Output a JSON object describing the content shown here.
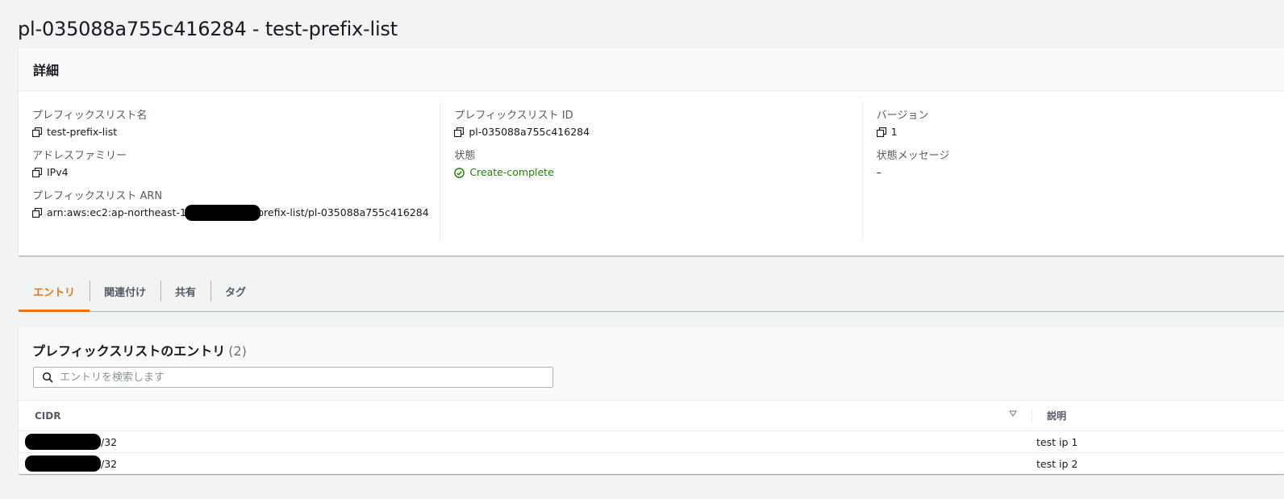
{
  "page": {
    "title": "pl-035088a755c416284 - test-prefix-list"
  },
  "details": {
    "header": "詳細",
    "fields": {
      "name_label": "プレフィックスリスト名",
      "name_value": "test-prefix-list",
      "family_label": "アドレスファミリー",
      "family_value": "IPv4",
      "arn_label": "プレフィックスリスト ARN",
      "arn_prefix": "arn:aws:ec2:ap-northeast-1:",
      "arn_suffix": "prefix-list/pl-035088a755c416284",
      "id_label": "プレフィックスリスト ID",
      "id_value": "pl-035088a755c416284",
      "state_label": "状態",
      "state_value": "Create-complete",
      "version_label": "バージョン",
      "version_value": "1",
      "state_message_label": "状態メッセージ",
      "state_message_value": "–"
    }
  },
  "tabs": [
    {
      "label": "エントリ",
      "active": true
    },
    {
      "label": "関連付け",
      "active": false
    },
    {
      "label": "共有",
      "active": false
    },
    {
      "label": "タグ",
      "active": false
    }
  ],
  "entries": {
    "title": "プレフィックスリストのエントリ",
    "count": "(2)",
    "search_placeholder": "エントリを検索します",
    "columns": {
      "cidr": "CIDR",
      "description": "説明"
    },
    "rows": [
      {
        "cidr_suffix": "/32",
        "description": "test ip 1"
      },
      {
        "cidr_suffix": "/32",
        "description": "test ip 2"
      }
    ]
  },
  "colors": {
    "accent": "#ec7211",
    "success": "#1d8102",
    "background": "#f2f3f3"
  },
  "icons": [
    "copy-icon",
    "status-success-icon",
    "search-icon",
    "sort-icon"
  ]
}
